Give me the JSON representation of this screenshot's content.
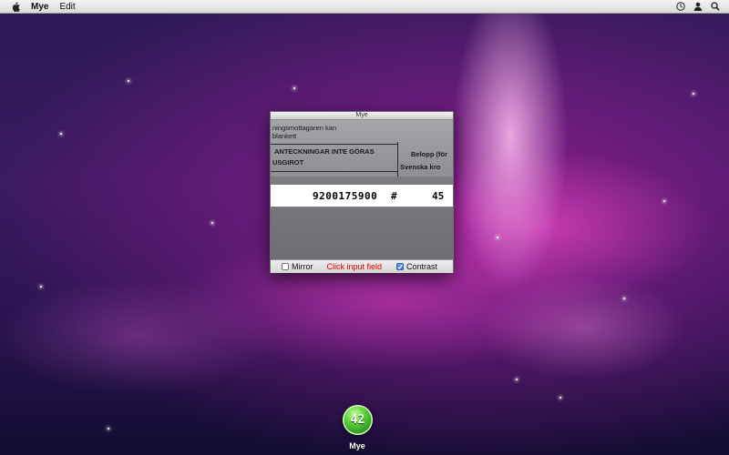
{
  "menubar": {
    "app_name": "Mye",
    "menus": [
      "Edit"
    ],
    "icons": [
      "apple-icon",
      "clock-icon",
      "user-icon",
      "spotlight-icon"
    ]
  },
  "window": {
    "title": "Mye",
    "camera": {
      "doc_text": [
        "ningsmottagaren kan",
        "blankett",
        "ANTECKNINGAR INTE GÖRAS",
        "USGIROT",
        "Belopp (för",
        "Svenska kro"
      ],
      "ocr_number": "9200175900",
      "ocr_hash": "#",
      "ocr_tail": "45"
    },
    "toolbar": {
      "mirror_label": "Mirror",
      "mirror_checked": false,
      "status_text": "Click input field",
      "status_color": "#e00000",
      "contrast_label": "Contrast",
      "contrast_checked": true
    }
  },
  "dock": {
    "app_label": "Mye",
    "icon_text": "42",
    "icon_color": "#3cbf2a"
  }
}
